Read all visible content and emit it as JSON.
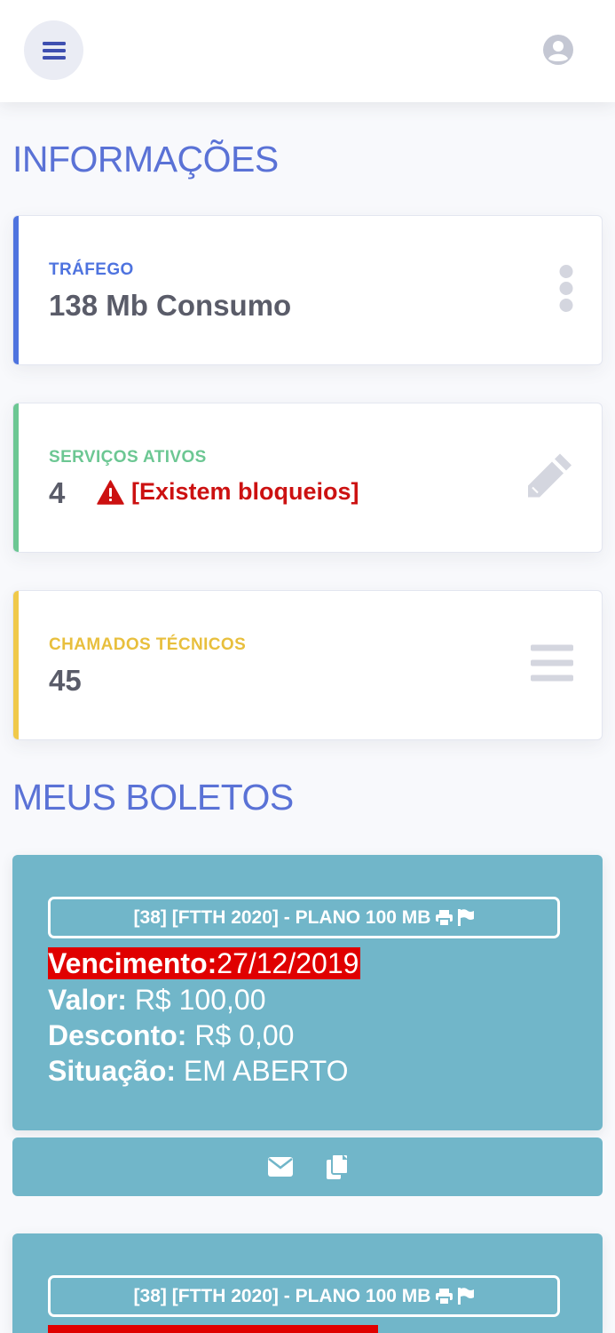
{
  "colors": {
    "primary": "#4e73df",
    "success": "#6cc793",
    "warning": "#f0c94a",
    "danger": "#cc1111",
    "info": "#71b6c9"
  },
  "header": {
    "menu_icon": "hamburger-icon",
    "avatar_icon": "user-circle-icon"
  },
  "sections": {
    "info_title": "INFORMAÇÕES",
    "boletos_title": "MEUS BOLETOS"
  },
  "cards": {
    "trafego": {
      "label": "TRÁFEGO",
      "value": "138 Mb Consumo",
      "icon": "ellipsis-vertical-icon"
    },
    "servicos": {
      "label": "SERVIÇOS ATIVOS",
      "value": "4",
      "warning": "[Existem bloqueios]",
      "icon": "pencil-icon"
    },
    "chamados": {
      "label": "CHAMADOS TÉCNICOS",
      "value": "45",
      "icon": "bars-icon"
    }
  },
  "boletos": [
    {
      "plan": "[38] [FTTH 2020] - PLANO 100 MB",
      "vencimento_label": "Vencimento:",
      "vencimento": "27/12/2019",
      "valor_label": "Valor:",
      "valor": "R$ 100,00",
      "desconto_label": "Desconto:",
      "desconto": "R$ 0,00",
      "situacao_label": "Situação:",
      "situacao": "EM ABERTO"
    },
    {
      "plan": "[38] [FTTH 2020] - PLANO 100 MB"
    }
  ]
}
